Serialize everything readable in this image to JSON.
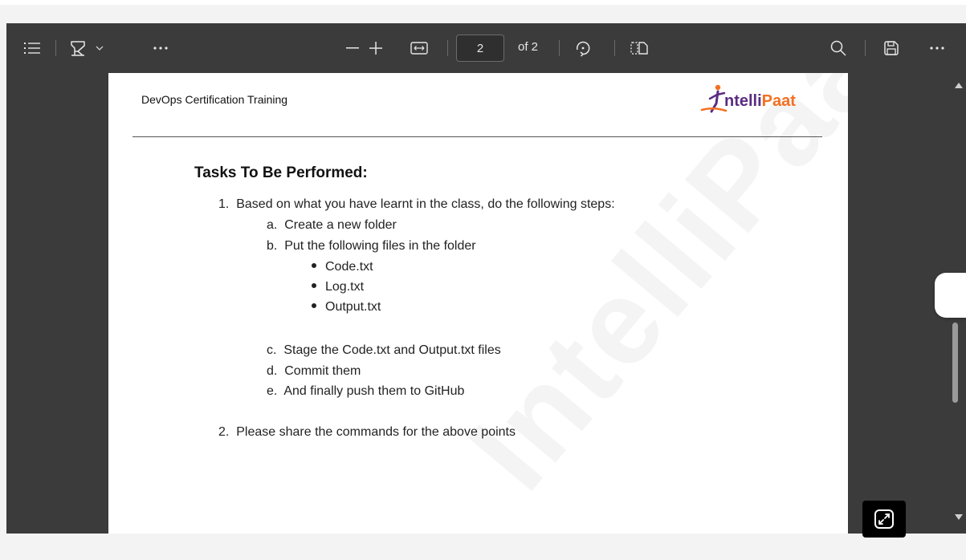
{
  "toolbar": {
    "icons": {
      "contents": "contents-list-icon",
      "highlight": "highlight-pen-icon",
      "highlight_menu": "chevron-down-icon",
      "more_left": "more-icon",
      "zoom_out": "minus-icon",
      "zoom_in": "plus-icon",
      "fit": "fit-width-icon",
      "rotate": "rotate-icon",
      "page_view": "page-view-icon",
      "search": "search-icon",
      "save": "save-icon",
      "more_right": "more-icon"
    },
    "current_page": "2",
    "of_pages": "of 2"
  },
  "document": {
    "header_text": "DevOps Certification Training",
    "logo": {
      "part1": "ntelli",
      "part2": "Paat"
    },
    "watermark": "IntelliPaat",
    "title": "Tasks To Be Performed:",
    "items": [
      {
        "marker": "1.",
        "text": "Based on what you have learnt in the class, do the following steps:"
      },
      {
        "marker": "a.",
        "text": "Create a new folder"
      },
      {
        "marker": "b.",
        "text": "Put the following files in the folder"
      },
      {
        "marker": "bullet",
        "text": "Code.txt"
      },
      {
        "marker": "bullet",
        "text": "Log.txt"
      },
      {
        "marker": "bullet",
        "text": "Output.txt"
      },
      {
        "marker": "c.",
        "text": "Stage the Code.txt and Output.txt files"
      },
      {
        "marker": "d.",
        "text": "Commit them"
      },
      {
        "marker": "e.",
        "text": "And finally push them to GitHub"
      },
      {
        "marker": "2.",
        "text": "Please share the commands for the above points"
      }
    ]
  },
  "colors": {
    "toolbar_bg": "#3b3b3b",
    "page_bg": "#ffffff",
    "logo_purple": "#5b2c83",
    "logo_orange": "#f37021"
  }
}
